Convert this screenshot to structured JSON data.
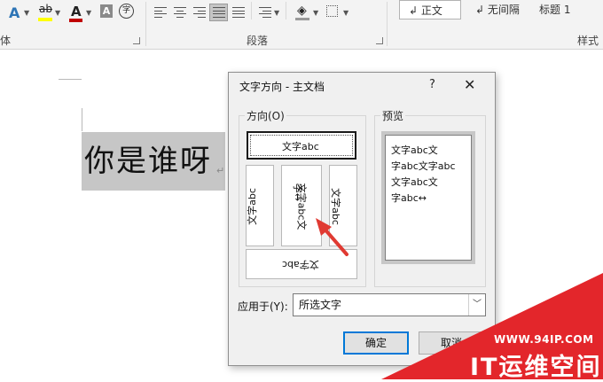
{
  "ribbon": {
    "font_group_label_partial": "体",
    "paragraph_group_label": "段落",
    "styles_group_label": "样式",
    "styles": [
      {
        "label": "↲ 正文",
        "selected": true
      },
      {
        "label": "↲ 无间隔",
        "selected": false
      },
      {
        "label": "标题 1",
        "selected": false
      }
    ],
    "font_icons": {
      "text_effects": "A",
      "highlight": "ab",
      "font_color": "A",
      "char_shading": "A",
      "enclose": "字"
    },
    "colors": {
      "accent": "#2e75b6",
      "highlight": "#ffff00",
      "font_color": "#c00000"
    }
  },
  "document": {
    "selected_text": "你是谁呀",
    "paragraph_mark": "↵"
  },
  "dialog": {
    "title": "文字方向 - 主文档",
    "help": "?",
    "close": "✕",
    "direction_label": "方向(O)",
    "preview_label": "预览",
    "options": {
      "horizontal": "文字abc",
      "vertical_left": "文字abc",
      "vertical_middle_col1": "文字abc文",
      "vertical_middle_col2": "字↔",
      "vertical_right": "文字abc",
      "rotated": "文字abc"
    },
    "preview_lines": [
      "文字abc文",
      "字abc文字abc",
      "文字abc文",
      "字abc↔"
    ],
    "apply_label": "应用于(Y):",
    "apply_value": "所选文字",
    "ok": "确定",
    "cancel": "取消"
  },
  "watermark": {
    "url": "WWW.94IP.COM",
    "name": "IT运维空间",
    "color": "#e3262b"
  }
}
